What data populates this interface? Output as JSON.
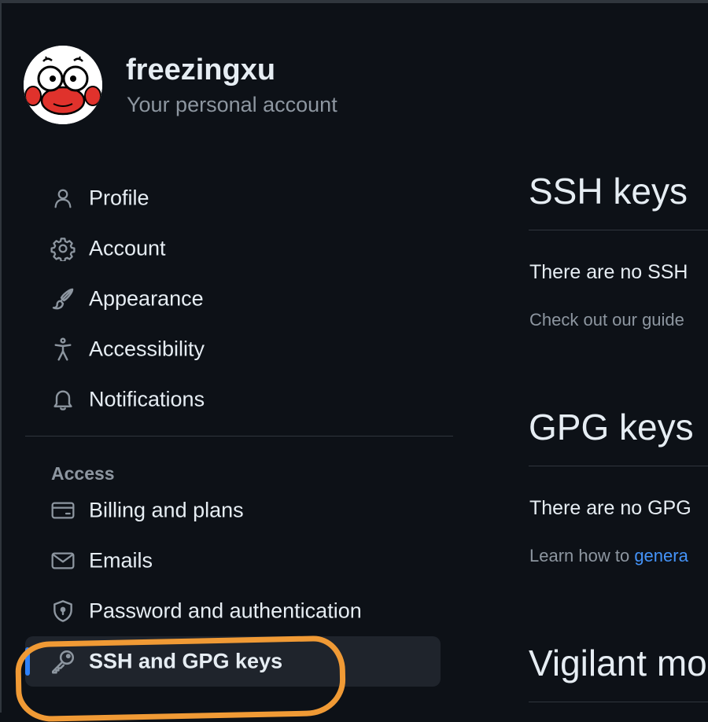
{
  "profile": {
    "username": "freezingxu",
    "subtitle": "Your personal account",
    "avatar_icon": "crab-avatar-icon"
  },
  "nav": {
    "items": [
      {
        "label": "Profile",
        "icon": "person-icon"
      },
      {
        "label": "Account",
        "icon": "gear-icon"
      },
      {
        "label": "Appearance",
        "icon": "paintbrush-icon"
      },
      {
        "label": "Accessibility",
        "icon": "accessibility-icon"
      },
      {
        "label": "Notifications",
        "icon": "bell-icon"
      }
    ],
    "access_title": "Access",
    "access_items": [
      {
        "label": "Billing and plans",
        "icon": "credit-card-icon"
      },
      {
        "label": "Emails",
        "icon": "mail-icon"
      },
      {
        "label": "Password and authentication",
        "icon": "shield-lock-icon"
      },
      {
        "label": "SSH and GPG keys",
        "icon": "key-icon",
        "active": true
      }
    ]
  },
  "content": {
    "ssh_title": "SSH keys",
    "ssh_empty": "There are no SSH",
    "ssh_guide": "Check out our guide",
    "gpg_title": "GPG keys",
    "gpg_empty": "There are no GPG",
    "gpg_learn_prefix": "Learn how to ",
    "gpg_learn_link": "genera",
    "vigilant_title": "Vigilant mo"
  },
  "colors": {
    "background": "#0d1117",
    "text": "#e6edf3",
    "muted": "#8d96a0",
    "accent": "#2f81f7",
    "link": "#4493f8",
    "annotation": "#f09a35",
    "active_bg": "#1f242c"
  }
}
